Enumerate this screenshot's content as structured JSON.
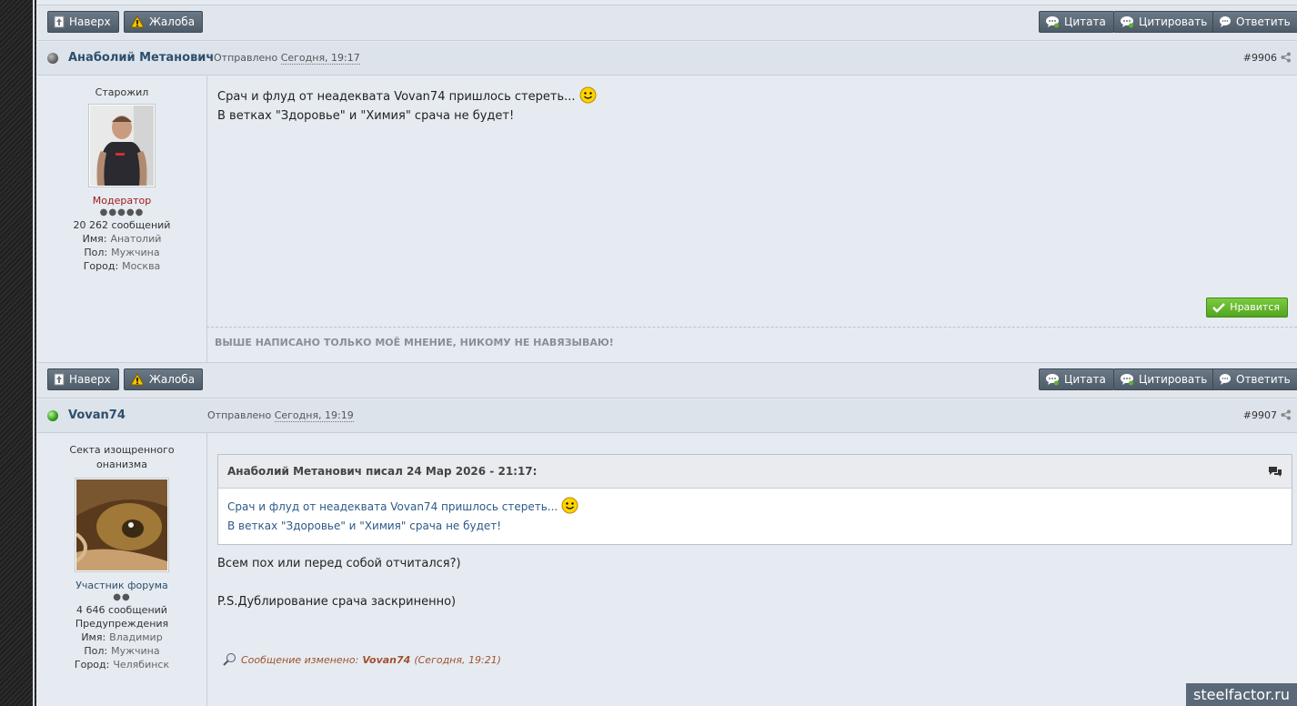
{
  "toolbar": {
    "top_label": "Наверх",
    "report_label": "Жалоба",
    "quote_label": "Цитата",
    "multiquote_label": "Цитировать",
    "reply_label": "Ответить"
  },
  "posts": [
    {
      "author": "Анаболий Метанович",
      "posted_prefix": "Отправлено",
      "posted_date": "Сегодня, 19:17",
      "number": "#9906",
      "user_title": "Старожил",
      "role": "Модератор",
      "pips": "●●●●●",
      "messages": "20 262 сообщений",
      "name_label": "Имя:",
      "name_value": "Анатолий",
      "gender_label": "Пол:",
      "gender_value": "Мужчина",
      "city_label": "Город:",
      "city_value": "Москва",
      "body_line1": "Срач и флуд от неадеквата Vovan74 пришлось стереть...",
      "body_line2": "В ветках \"Здоровье\" и \"Химия\" срача не будет!",
      "like_label": "Нравится",
      "signature": "Выше написано только моё мнение, никому не навязываю!"
    },
    {
      "author": "Vovan74",
      "posted_prefix": "Отправлено",
      "posted_date": "Сегодня, 19:19",
      "number": "#9907",
      "user_title": "Секта изощренного онанизма",
      "role": "Участник форума",
      "pips": "●●",
      "messages": "4 646 сообщений",
      "warnings": "Предупреждения",
      "name_label": "Имя:",
      "name_value": "Владимир",
      "gender_label": "Пол:",
      "gender_value": "Мужчина",
      "city_label": "Город:",
      "city_value": "Челябинск",
      "quote_header": "Анаболий Метанович писал 24 Мар 2026 - 21:17:",
      "quote_line1": "Срач и флуд от неадеквата Vovan74 пришлось стереть...",
      "quote_line2": "В ветках \"Здоровье\" и \"Химия\" срача не будет!",
      "body_line1": "Всем пох или перед собой отчитался?)",
      "body_line2": "P.S.Дублирование срача заскриненно)",
      "edited_prefix": "Сообщение изменено:",
      "edited_by": "Vovan74",
      "edited_when": "(Сегодня, 19:21)"
    }
  ],
  "watermark": "steelfactor.ru",
  "colors": {
    "button_bg": "#5d6a78",
    "like_green": "#5fb02a",
    "moderator_red": "#a01a1a",
    "author_blue": "#2d4f6e",
    "quote_text": "#2d5a8a",
    "edited_brown": "#a0522d"
  }
}
